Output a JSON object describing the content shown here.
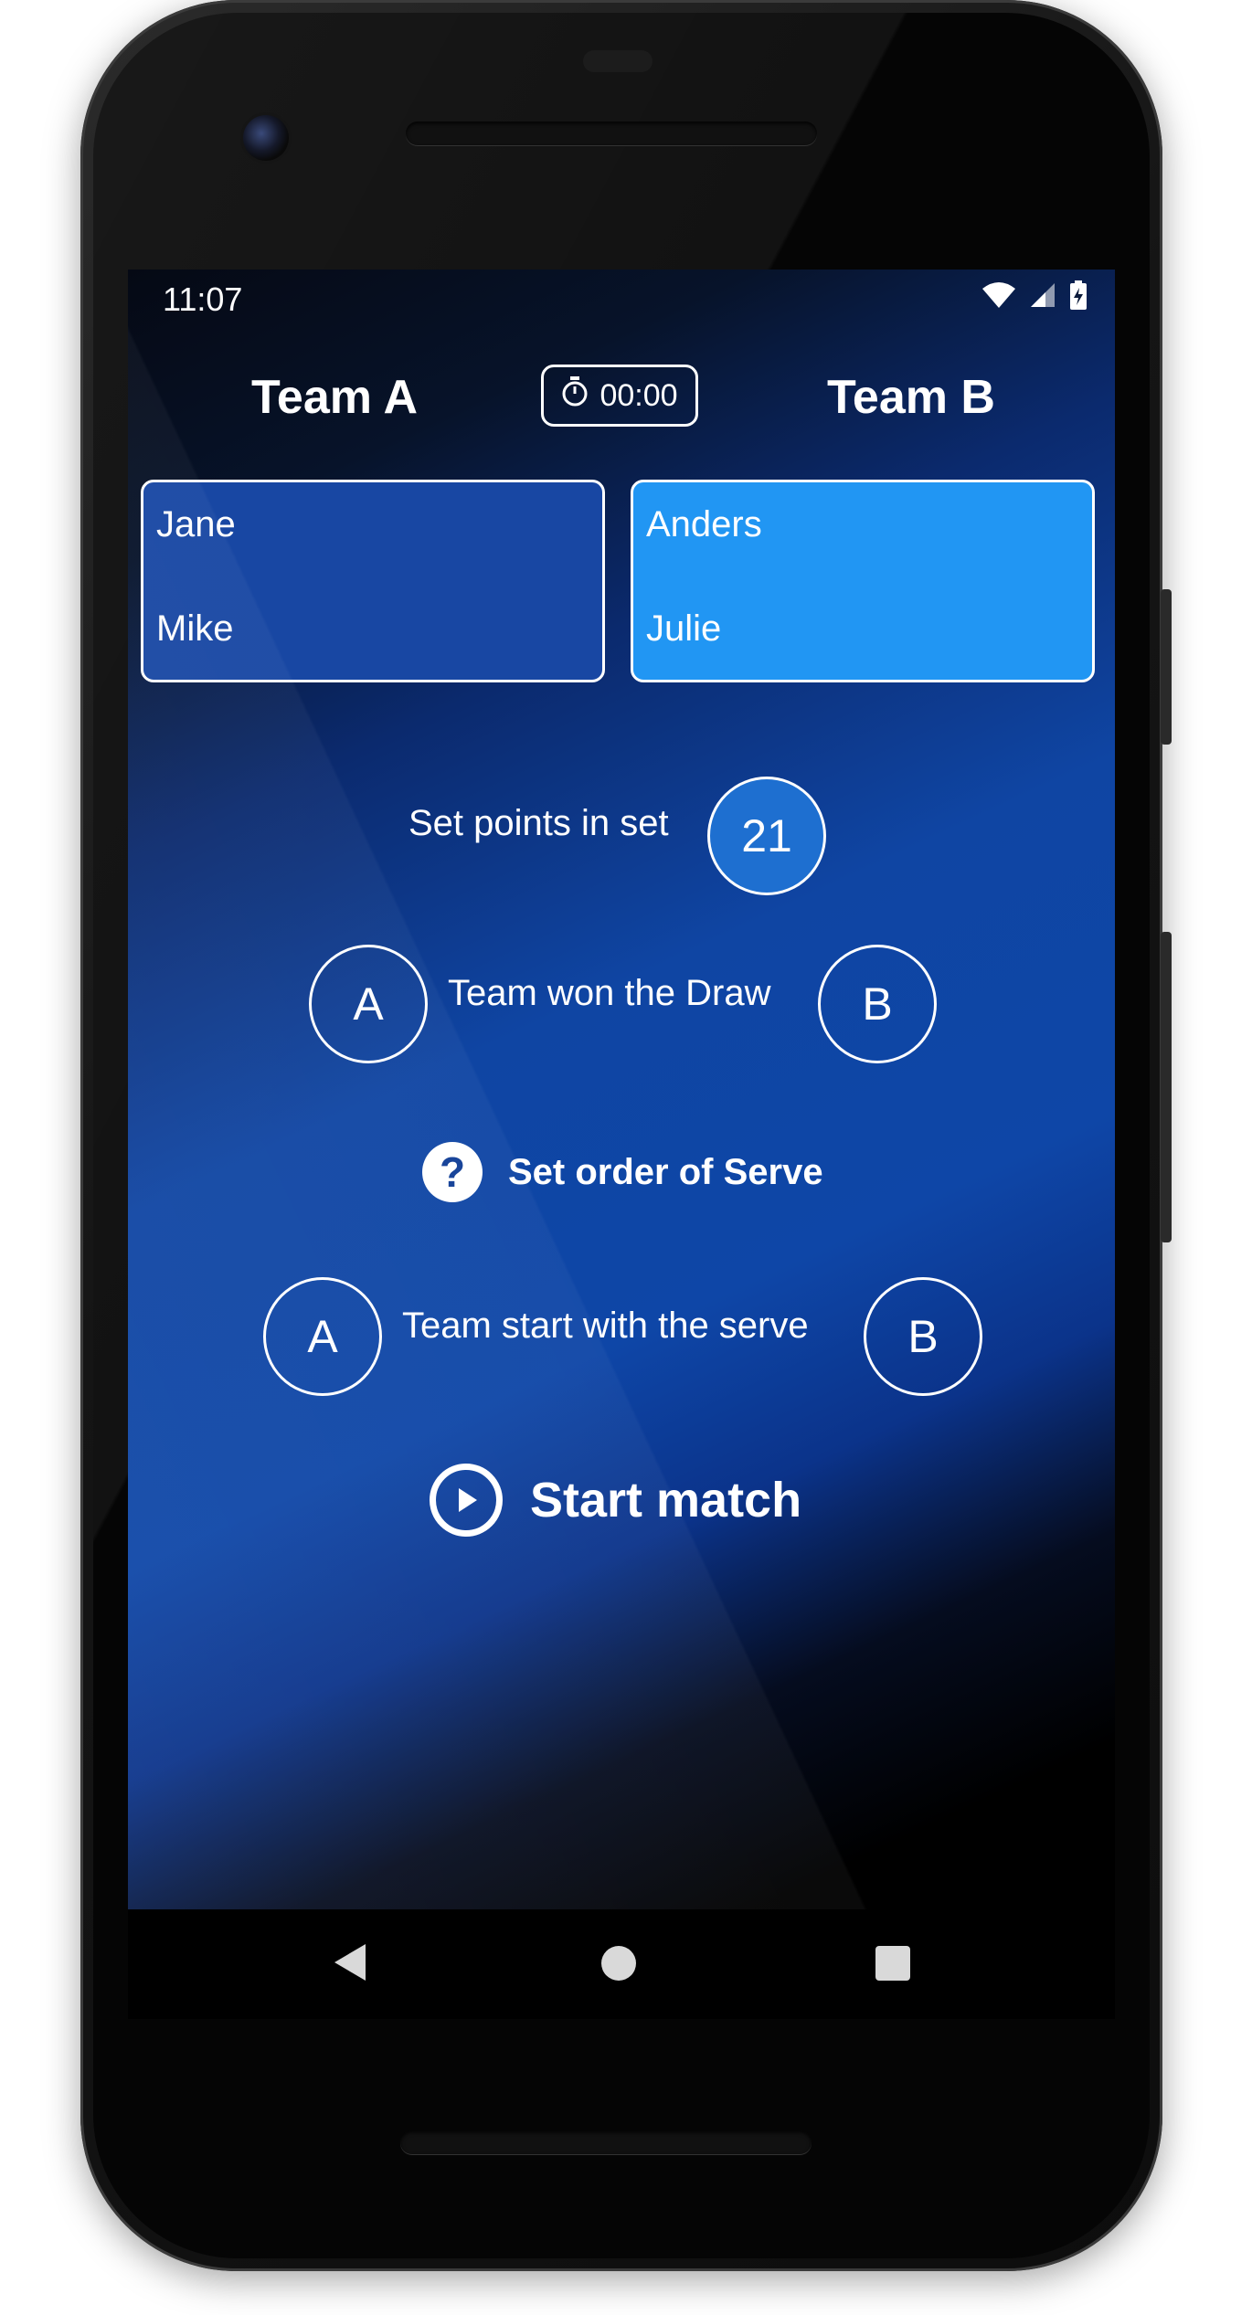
{
  "status_bar": {
    "time": "11:07",
    "icons": [
      "wifi-icon",
      "signal-icon",
      "battery-charging-icon"
    ]
  },
  "header": {
    "team_a_title": "Team A",
    "team_b_title": "Team B",
    "timer": "00:00",
    "timer_icon": "stopwatch-icon"
  },
  "teams": {
    "team_a": {
      "players": [
        "Jane",
        "Mike"
      ],
      "color": "#1847a3"
    },
    "team_b": {
      "players": [
        "Anders",
        "Julie"
      ],
      "color": "#2196f3"
    }
  },
  "set_points": {
    "label": "Set points in set",
    "value": "21"
  },
  "draw": {
    "label": "Team won the Draw",
    "option_a": "A",
    "option_b": "B"
  },
  "serve_order": {
    "label": "Set order of Serve",
    "icon": "help-icon",
    "icon_glyph": "?"
  },
  "serve_start": {
    "label": "Team start with the serve",
    "option_a": "A",
    "option_b": "B"
  },
  "start_match": {
    "label": "Start match",
    "icon": "play-icon"
  },
  "nav": {
    "back": "back-icon",
    "home": "home-icon",
    "recents": "recents-icon"
  }
}
